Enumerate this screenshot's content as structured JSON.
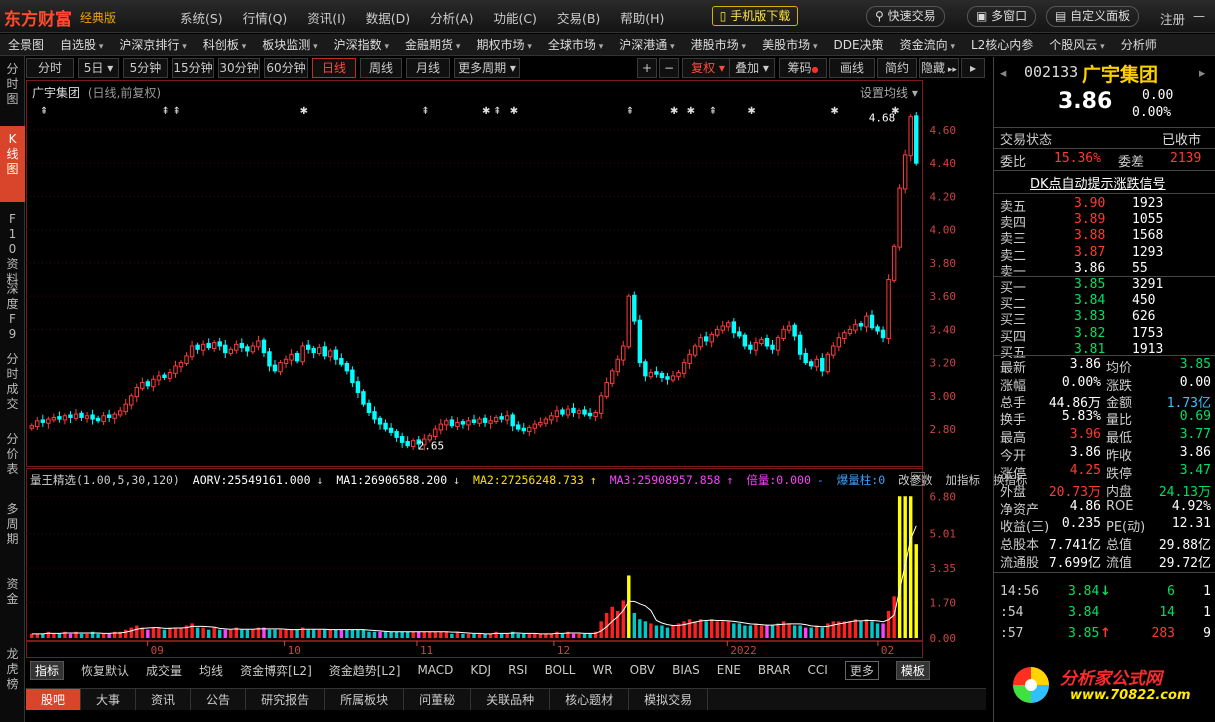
{
  "app": {
    "brand": "东方财富",
    "edition": "经典版"
  },
  "menu": [
    "系统(S)",
    "行情(Q)",
    "资讯(I)",
    "数据(D)",
    "分析(A)",
    "功能(C)",
    "交易(B)",
    "帮助(H)"
  ],
  "titlebar": {
    "mobile": "手机版下载",
    "quick_trade": "快速交易",
    "multi_window": "多窗口",
    "custom_panel": "自定义面板",
    "register": "注册"
  },
  "nav": [
    "全景图",
    "自选股",
    "沪深京排行",
    "科创板",
    "板块监测",
    "沪深指数",
    "金融期货",
    "期权市场",
    "全球市场",
    "沪深港通",
    "港股市场",
    "美股市场",
    "DDE决策",
    "资金流向",
    "L2核心内参",
    "个股风云",
    "分析师"
  ],
  "nav_dropdown": [
    false,
    true,
    true,
    true,
    true,
    true,
    true,
    true,
    true,
    true,
    true,
    true,
    false,
    true,
    false,
    true,
    false
  ],
  "left_tabs": [
    "分时图",
    "K线图",
    "F10资料",
    "深度F9",
    "分时成交",
    "分价表",
    "多周期",
    "资金",
    "龙虎榜"
  ],
  "periods": [
    "分时",
    "5日",
    "5分钟",
    "15分钟",
    "30分钟",
    "60分钟",
    "日线",
    "周线",
    "月线",
    "更多周期"
  ],
  "tools": {
    "plus": "+",
    "minus": "−",
    "fuquan": "复权",
    "overlay": "叠加",
    "chips": "筹码",
    "draw": "画线",
    "simple": "简约",
    "hide": "隐藏"
  },
  "chart": {
    "stock_name": "广宇集团",
    "mode": "(日线,前复权)",
    "set_ma": "设置均线"
  },
  "indicator": {
    "name": "量王精选(1.00,5,30,120)",
    "aorv": "AORV:25549161.000",
    "ma1": "MA1:26906588.200",
    "ma2": "MA2:27256248.733",
    "ma3": "MA3:25908957.858",
    "beiliang": "倍量:0.000",
    "baoliang": "爆量柱:0",
    "change_param": "改参数",
    "add_ind": "加指标",
    "swap_ind": "换指标"
  },
  "indicator_tabs": [
    "指标",
    "恢复默认",
    "成交量",
    "均线",
    "资金博弈[L2]",
    "资金趋势[L2]",
    "MACD",
    "KDJ",
    "RSI",
    "BOLL",
    "WR",
    "OBV",
    "BIAS",
    "ENE",
    "BRAR",
    "CCI",
    "更多",
    "模板"
  ],
  "bottom_tabs": [
    "股吧",
    "大事",
    "资讯",
    "公告",
    "研究报告",
    "所属板块",
    "问董秘",
    "关联品种",
    "核心题材",
    "模拟交易"
  ],
  "quote": {
    "code": "002133",
    "name": "广宇集团",
    "price": "3.86",
    "change": "0.00",
    "pct": "0.00%",
    "trade_state_label": "交易状态",
    "trade_state": "已收市",
    "weibi_label": "委比",
    "weibi": "15.36%",
    "weicha_label": "委差",
    "weicha": "2139",
    "dk_signal": "DK点自动提示涨跌信号",
    "asks": [
      {
        "label": "卖五",
        "price": "3.90",
        "vol": "1923"
      },
      {
        "label": "卖四",
        "price": "3.89",
        "vol": "1055"
      },
      {
        "label": "卖三",
        "price": "3.88",
        "vol": "1568"
      },
      {
        "label": "卖二",
        "price": "3.87",
        "vol": "1293"
      },
      {
        "label": "卖一",
        "price": "3.86",
        "vol": "55"
      }
    ],
    "bids": [
      {
        "label": "买一",
        "price": "3.85",
        "vol": "3291"
      },
      {
        "label": "买二",
        "price": "3.84",
        "vol": "450"
      },
      {
        "label": "买三",
        "price": "3.83",
        "vol": "626"
      },
      {
        "label": "买四",
        "price": "3.82",
        "vol": "1753"
      },
      {
        "label": "买五",
        "price": "3.81",
        "vol": "1913"
      }
    ],
    "stats": [
      [
        "最新",
        "3.86",
        "white",
        "均价",
        "3.85",
        "green"
      ],
      [
        "涨幅",
        "0.00%",
        "white",
        "涨跌",
        "0.00",
        "white"
      ],
      [
        "总手",
        "44.86万",
        "white",
        "金额",
        "1.73亿",
        "cyan"
      ],
      [
        "换手",
        "5.83%",
        "white",
        "量比",
        "0.69",
        "green"
      ],
      [
        "最高",
        "3.96",
        "red",
        "最低",
        "3.77",
        "green"
      ],
      [
        "今开",
        "3.86",
        "white",
        "昨收",
        "3.86",
        "white"
      ],
      [
        "涨停",
        "4.25",
        "red",
        "跌停",
        "3.47",
        "green"
      ],
      [
        "外盘",
        "20.73万",
        "red",
        "内盘",
        "24.13万",
        "green"
      ],
      [
        "净资产",
        "4.86",
        "white",
        "ROE",
        "4.92%",
        "white"
      ],
      [
        "收益(三)",
        "0.235",
        "white",
        "PE(动)",
        "12.31",
        "white"
      ],
      [
        "总股本",
        "7.741亿",
        "white",
        "总值",
        "29.88亿",
        "white"
      ],
      [
        "流通股",
        "7.699亿",
        "white",
        "流值",
        "29.72亿",
        "white"
      ]
    ],
    "ticks": [
      {
        "time": "14:56",
        "price": "3.84",
        "arrow": "↓",
        "vol": "6",
        "n": "1",
        "color": "green",
        "volcolor": "green"
      },
      {
        "time": ":54",
        "price": "3.84",
        "arrow": "",
        "vol": "14",
        "n": "1",
        "color": "green",
        "volcolor": "green"
      },
      {
        "time": ":57",
        "price": "3.85",
        "arrow": "↑",
        "vol": "283",
        "n": "9",
        "color": "green",
        "volcolor": "red"
      }
    ]
  },
  "watermark": {
    "line1": "分析家公式网",
    "line2": "www.70822.com"
  },
  "chart_data": {
    "type": "candlestick",
    "ylim": [
      2.65,
      4.72
    ],
    "y_ticks": [
      "4.60",
      "4.40",
      "4.20",
      "4.00",
      "3.80",
      "3.60",
      "3.40",
      "3.20",
      "3.00",
      "2.80"
    ],
    "x_ticks": [
      "09",
      "10",
      "11",
      "12",
      "2022",
      "02"
    ],
    "annotations": [
      {
        "label": "4.68"
      },
      {
        "label": "2.65"
      }
    ],
    "indicator_ylim": [
      0,
      7.1
    ],
    "indicator_ticks": [
      "6.80",
      "5.01",
      "3.35",
      "1.70",
      "0.00"
    ],
    "closes": [
      2.82,
      2.85,
      2.84,
      2.86,
      2.87,
      2.86,
      2.88,
      2.87,
      2.89,
      2.87,
      2.88,
      2.86,
      2.85,
      2.88,
      2.87,
      2.89,
      2.91,
      2.95,
      3.0,
      3.05,
      3.08,
      3.06,
      3.1,
      3.12,
      3.11,
      3.14,
      3.18,
      3.2,
      3.24,
      3.3,
      3.28,
      3.31,
      3.29,
      3.32,
      3.3,
      3.26,
      3.28,
      3.31,
      3.29,
      3.27,
      3.3,
      3.33,
      3.26,
      3.18,
      3.15,
      3.2,
      3.22,
      3.25,
      3.21,
      3.3,
      3.28,
      3.26,
      3.29,
      3.24,
      3.27,
      3.22,
      3.19,
      3.15,
      3.08,
      3.02,
      2.95,
      2.9,
      2.86,
      2.83,
      2.8,
      2.78,
      2.75,
      2.72,
      2.7,
      2.73,
      2.71,
      2.74,
      2.76,
      2.8,
      2.83,
      2.85,
      2.82,
      2.84,
      2.83,
      2.85,
      2.84,
      2.86,
      2.84,
      2.85,
      2.87,
      2.86,
      2.88,
      2.82,
      2.8,
      2.79,
      2.81,
      2.83,
      2.84,
      2.86,
      2.88,
      2.91,
      2.89,
      2.92,
      2.9,
      2.91,
      2.89,
      2.88,
      2.9,
      3.0,
      3.08,
      3.15,
      3.22,
      3.3,
      3.6,
      3.45,
      3.2,
      3.12,
      3.14,
      3.13,
      3.11,
      3.1,
      3.12,
      3.14,
      3.2,
      3.25,
      3.3,
      3.35,
      3.33,
      3.37,
      3.4,
      3.42,
      3.44,
      3.38,
      3.36,
      3.3,
      3.28,
      3.32,
      3.34,
      3.3,
      3.28,
      3.35,
      3.4,
      3.42,
      3.36,
      3.25,
      3.2,
      3.18,
      3.22,
      3.15,
      3.25,
      3.3,
      3.35,
      3.38,
      3.4,
      3.43,
      3.42,
      3.48,
      3.41,
      3.39,
      3.35,
      3.7,
      3.9,
      4.25,
      4.45,
      4.68,
      4.4
    ],
    "volumes": [
      0.2,
      0.2,
      0.2,
      0.3,
      0.2,
      0.2,
      0.3,
      0.2,
      0.3,
      0.2,
      0.2,
      0.3,
      0.2,
      0.2,
      0.2,
      0.3,
      0.3,
      0.4,
      0.5,
      0.6,
      0.5,
      0.4,
      0.5,
      0.5,
      0.4,
      0.5,
      0.5,
      0.5,
      0.6,
      0.7,
      0.5,
      0.5,
      0.4,
      0.5,
      0.4,
      0.4,
      0.4,
      0.5,
      0.4,
      0.4,
      0.4,
      0.5,
      0.5,
      0.4,
      0.4,
      0.4,
      0.4,
      0.4,
      0.4,
      0.5,
      0.4,
      0.4,
      0.4,
      0.4,
      0.4,
      0.4,
      0.4,
      0.4,
      0.4,
      0.4,
      0.4,
      0.3,
      0.3,
      0.3,
      0.3,
      0.3,
      0.3,
      0.3,
      0.3,
      0.3,
      0.3,
      0.3,
      0.3,
      0.3,
      0.3,
      0.3,
      0.2,
      0.3,
      0.2,
      0.2,
      0.2,
      0.2,
      0.2,
      0.2,
      0.3,
      0.2,
      0.2,
      0.3,
      0.2,
      0.2,
      0.2,
      0.2,
      0.2,
      0.2,
      0.2,
      0.3,
      0.2,
      0.3,
      0.2,
      0.2,
      0.2,
      0.2,
      0.3,
      0.8,
      1.2,
      1.5,
      1.3,
      1.8,
      3.0,
      1.2,
      0.9,
      0.8,
      0.7,
      0.6,
      0.6,
      0.5,
      0.6,
      0.7,
      0.8,
      0.9,
      0.8,
      0.9,
      0.8,
      0.9,
      0.8,
      0.8,
      0.8,
      0.7,
      0.7,
      0.6,
      0.6,
      0.7,
      0.6,
      0.6,
      0.6,
      0.7,
      0.8,
      0.7,
      0.6,
      0.6,
      0.5,
      0.5,
      0.6,
      0.5,
      0.7,
      0.8,
      0.8,
      0.8,
      0.8,
      0.9,
      0.8,
      0.9,
      0.8,
      0.7,
      0.7,
      1.3,
      2.0,
      6.8,
      6.8,
      6.8,
      4.5
    ]
  }
}
